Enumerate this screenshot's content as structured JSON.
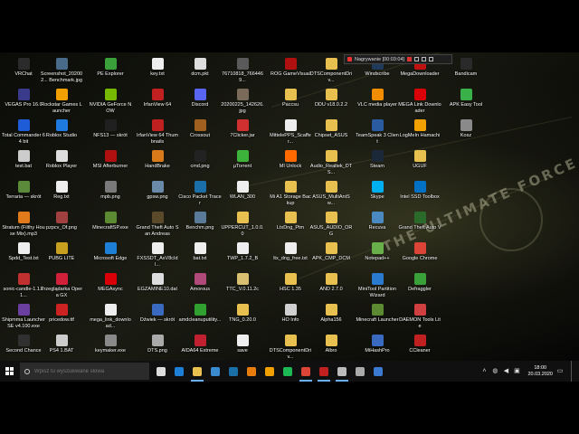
{
  "desktop": {
    "wallpaper_text": "THE ULTIMATE FORCE",
    "columns": [
      [
        {
          "label": "VRChat",
          "icon": "vrchat-icon",
          "color": "#2b2b2b"
        },
        {
          "label": "VEGAS Pro 16.0",
          "icon": "vegas-icon",
          "color": "#3a3a8a"
        },
        {
          "label": "Total Commander 64 bit",
          "icon": "total-commander-icon",
          "color": "#1e5bd6"
        },
        {
          "label": "test.bat",
          "icon": "bat-file-icon",
          "color": "#cccccc"
        },
        {
          "label": "Terraria — skrót",
          "icon": "terraria-icon",
          "color": "#5a8a3a"
        },
        {
          "label": "Stratum (Filthy House Mix).mp3",
          "icon": "mp3-icon",
          "color": "#e07a1a"
        },
        {
          "label": "Spdd_Test.txt",
          "icon": "txt-file-icon",
          "color": "#eeeeee"
        },
        {
          "label": "sonic-candle-1.1.11...",
          "icon": "jar-file-icon",
          "color": "#c03030"
        },
        {
          "label": "Shipmma Launcher SE v4.100.exe",
          "icon": "exe-icon",
          "color": "#6a3fa0"
        },
        {
          "label": "Second Chance",
          "icon": "game-icon",
          "color": "#303030"
        }
      ],
      [
        {
          "label": "Screenshot_202002... Benchmark.jpg",
          "icon": "image-file-icon",
          "color": "#4a6a8a"
        },
        {
          "label": "Rockstar Games Launcher",
          "icon": "rockstar-icon",
          "color": "#f2a000"
        },
        {
          "label": "Roblox Studio",
          "icon": "roblox-studio-icon",
          "color": "#1f7ae0"
        },
        {
          "label": "Roblox Player",
          "icon": "roblox-icon",
          "color": "#dddddd"
        },
        {
          "label": "Reg.txt",
          "icon": "txt-file-icon",
          "color": "#eeeeee"
        },
        {
          "label": "pzpcv_Of.png",
          "icon": "png-file-icon",
          "color": "#a04040"
        },
        {
          "label": "PUBG LITE",
          "icon": "pubg-icon",
          "color": "#c8a020"
        },
        {
          "label": "Przeglądarka Opera GX",
          "icon": "opera-gx-icon",
          "color": "#d0203a"
        },
        {
          "label": "pricedow.ttf",
          "icon": "font-file-icon",
          "color": "#cc2222"
        },
        {
          "label": "PS4 1.BAT",
          "icon": "bat-file-icon",
          "color": "#cccccc"
        }
      ],
      [
        {
          "label": "PE Explorer",
          "icon": "pe-explorer-icon",
          "color": "#3aa03a"
        },
        {
          "label": "NVIDIA GeForce NOW",
          "icon": "nvidia-icon",
          "color": "#76b900"
        },
        {
          "label": "NFS13 — skrót",
          "icon": "nfs-icon",
          "color": "#202020"
        },
        {
          "label": "MSI Afterburner",
          "icon": "msi-afterburner-icon",
          "color": "#b01010"
        },
        {
          "label": "mpb.png",
          "icon": "png-file-icon",
          "color": "#7a7a7a"
        },
        {
          "label": "MinecraftSP.exe",
          "icon": "minecraft-icon",
          "color": "#5b8a32"
        },
        {
          "label": "Microsoft Edge",
          "icon": "edge-icon",
          "color": "#1e7fd6"
        },
        {
          "label": "MEGAsync",
          "icon": "mega-icon",
          "color": "#d90007"
        },
        {
          "label": "mega_link_download...",
          "icon": "txt-file-icon",
          "color": "#eeeeee"
        },
        {
          "label": "keymaker.exe",
          "icon": "exe-icon",
          "color": "#8a8a8a"
        }
      ],
      [
        {
          "label": "key.txt",
          "icon": "txt-file-icon",
          "color": "#eeeeee"
        },
        {
          "label": "IrfanView 64",
          "icon": "irfanview-icon",
          "color": "#c02020"
        },
        {
          "label": "IrfanView 64 Thumbnails",
          "icon": "irfanview-icon",
          "color": "#c02020"
        },
        {
          "label": "HandBrake",
          "icon": "handbrake-icon",
          "color": "#d87a1a"
        },
        {
          "label": "gpsw.png",
          "icon": "png-file-icon",
          "color": "#6a8aaa"
        },
        {
          "label": "Grand Theft Auto San Andreas",
          "icon": "gta-sa-icon",
          "color": "#5a4a2a"
        },
        {
          "label": "FXSSDT_AxV8cIdl...",
          "icon": "txt-file-icon",
          "color": "#eeeeee"
        },
        {
          "label": "EGZAMINE10.dat",
          "icon": "dat-file-icon",
          "color": "#dddddd"
        },
        {
          "label": "Dźwiek — skrót",
          "icon": "shortcut-icon",
          "color": "#3a6ac0"
        },
        {
          "label": "DTS.png",
          "icon": "png-file-icon",
          "color": "#aaaaaa"
        }
      ],
      [
        {
          "label": "dcm.pkt",
          "icon": "pkt-file-icon",
          "color": "#dddddd"
        },
        {
          "label": "Discord",
          "icon": "discord-icon",
          "color": "#5865f2"
        },
        {
          "label": "Crossout",
          "icon": "crossout-icon",
          "color": "#a06020"
        },
        {
          "label": "cmd.png",
          "icon": "png-file-icon",
          "color": "#222222"
        },
        {
          "label": "Cisco Packet Tracer",
          "icon": "cisco-icon",
          "color": "#1b6fa8"
        },
        {
          "label": "Benchm.png",
          "icon": "png-file-icon",
          "color": "#5a7a9a"
        },
        {
          "label": "bat.txt",
          "icon": "txt-file-icon",
          "color": "#eeeeee"
        },
        {
          "label": "Amorous",
          "icon": "game-icon",
          "color": "#b04a7a"
        },
        {
          "label": "amdcleanuputility...",
          "icon": "amd-icon",
          "color": "#30a030"
        },
        {
          "label": "AIDA64 Extreme",
          "icon": "aida64-icon",
          "color": "#c02030"
        }
      ],
      [
        {
          "label": "76710818_7664469...",
          "icon": "image-file-icon",
          "color": "#5a5a5a"
        },
        {
          "label": "20200225_142626.jpg",
          "icon": "image-file-icon",
          "color": "#7a6a5a"
        },
        {
          "label": "7Clicker.jar",
          "icon": "jar-file-icon",
          "color": "#d03030"
        },
        {
          "label": "µTorrent",
          "icon": "utorrent-icon",
          "color": "#3cb43c"
        },
        {
          "label": "WLAN_300",
          "icon": "txt-file-icon",
          "color": "#eeeeee"
        },
        {
          "label": "UPPERCUT_1.0.0.0",
          "icon": "folder-icon",
          "color": "#e8c050"
        },
        {
          "label": "TWP_1.7.2_B",
          "icon": "txt-file-icon",
          "color": "#eeeeee"
        },
        {
          "label": "TTC_V.0.11.2c",
          "icon": "exe-icon",
          "color": "#d8c070"
        },
        {
          "label": "TNG_0.20.0",
          "icon": "folder-icon",
          "color": "#e8c050"
        },
        {
          "label": "save",
          "icon": "txt-file-icon",
          "color": "#eeeeee"
        }
      ],
      [
        {
          "label": "ROG GameVisual",
          "icon": "rog-icon",
          "color": "#b01010"
        },
        {
          "label": "Paccsu",
          "icon": "folder-icon",
          "color": "#e8c050"
        },
        {
          "label": "MittelePPS_Scaffer...",
          "icon": "txt-file-icon",
          "color": "#eeeeee"
        },
        {
          "label": "MI Unlock",
          "icon": "mi-unlock-icon",
          "color": "#ff6900"
        },
        {
          "label": "Mi A1 Storage Backup",
          "icon": "folder-icon",
          "color": "#e8c050"
        },
        {
          "label": "LtxDng_Ptm",
          "icon": "folder-icon",
          "color": "#e8c050"
        },
        {
          "label": "ltx_dng_free.txt",
          "icon": "txt-file-icon",
          "color": "#eeeeee"
        },
        {
          "label": "HSC 1.35",
          "icon": "folder-icon",
          "color": "#e8c050"
        },
        {
          "label": "HO Info",
          "icon": "info-icon",
          "color": "#d0d0d0"
        },
        {
          "label": "DTSComponentDriv...",
          "icon": "folder-icon",
          "color": "#e8c050"
        }
      ],
      [
        {
          "label": "DTSComponentDriv...",
          "icon": "folder-icon",
          "color": "#e8c050"
        },
        {
          "label": "DDU v18.0.2.2",
          "icon": "folder-icon",
          "color": "#e8c050"
        },
        {
          "label": "Chipset_ASUS",
          "icon": "folder-icon",
          "color": "#e8c050"
        },
        {
          "label": "Audio_Realtek_DTS...",
          "icon": "folder-icon",
          "color": "#e8c050"
        },
        {
          "label": "ASUS_MultiAntSw...",
          "icon": "folder-icon",
          "color": "#e8c050"
        },
        {
          "label": "ASUS_AUDIO_ORG",
          "icon": "folder-icon",
          "color": "#e8c050"
        },
        {
          "label": "APK_CMP_DCM",
          "icon": "folder-icon",
          "color": "#e8c050"
        },
        {
          "label": "AND 2.7.0",
          "icon": "folder-icon",
          "color": "#e8c050"
        },
        {
          "label": "Alpha156",
          "icon": "folder-icon",
          "color": "#e8c050"
        },
        {
          "label": "Albro",
          "icon": "folder-icon",
          "color": "#e8c050"
        }
      ],
      [
        {
          "label": "Windscribe",
          "icon": "windscribe-icon",
          "color": "#1f3a5a"
        },
        {
          "label": "VLC media player",
          "icon": "vlc-icon",
          "color": "#f28c00"
        },
        {
          "label": "TeamSpeak 3 Client",
          "icon": "teamspeak-icon",
          "color": "#2a5aa0"
        },
        {
          "label": "Steam",
          "icon": "steam-icon",
          "color": "#1b2838"
        },
        {
          "label": "Skype",
          "icon": "skype-icon",
          "color": "#00aff0"
        },
        {
          "label": "Recuva",
          "icon": "recuva-icon",
          "color": "#4a8ac0"
        },
        {
          "label": "Notepad++",
          "icon": "notepadpp-icon",
          "color": "#6ab04a"
        },
        {
          "label": "MiniTool Partition Wizard",
          "icon": "minitool-icon",
          "color": "#2a7ad0"
        },
        {
          "label": "Minecraft Launcher",
          "icon": "minecraft-icon",
          "color": "#5b8a32"
        },
        {
          "label": "MiHashPro",
          "icon": "shortcut-icon",
          "color": "#3a6ac0"
        }
      ],
      [
        {
          "label": "MegaDownloader",
          "icon": "megadownloader-icon",
          "color": "#c01010"
        },
        {
          "label": "MEGA Link Downloader",
          "icon": "mega-icon",
          "color": "#d90007"
        },
        {
          "label": "LogMeIn Hamachi",
          "icon": "hamachi-icon",
          "color": "#f2a000"
        },
        {
          "label": "UGUF",
          "icon": "folder-icon",
          "color": "#e8c050"
        },
        {
          "label": "Intel SSD Toolbox",
          "icon": "intel-icon",
          "color": "#0071c5"
        },
        {
          "label": "Grand Theft Auto V",
          "icon": "gta-v-icon",
          "color": "#2a6a2a"
        },
        {
          "label": "Google Chrome",
          "icon": "chrome-icon",
          "color": "#db4437"
        },
        {
          "label": "Defraggler",
          "icon": "defraggler-icon",
          "color": "#3aa03a"
        },
        {
          "label": "DAEMON Tools Lite",
          "icon": "daemon-tools-icon",
          "color": "#d04040"
        },
        {
          "label": "CCleaner",
          "icon": "ccleaner-icon",
          "color": "#c02020"
        }
      ],
      [
        {
          "label": "Bandicam",
          "icon": "bandicam-icon",
          "color": "#2a2a2a"
        },
        {
          "label": "APK Easy Tool",
          "icon": "apk-icon",
          "color": "#3ab04a"
        },
        {
          "label": "Kosz",
          "icon": "recycle-bin-icon",
          "color": "#8a8a8a"
        }
      ]
    ]
  },
  "recorder": {
    "label": "Nagrywanie [00:03:04]"
  },
  "taskbar": {
    "search_placeholder": "Wpisz tu wyszukiwane słowa",
    "apps": [
      {
        "name": "task-view-icon",
        "color": "#dddddd",
        "active": false
      },
      {
        "name": "edge-icon",
        "color": "#1e7fd6",
        "active": false
      },
      {
        "name": "file-explorer-icon",
        "color": "#e8c050",
        "active": true
      },
      {
        "name": "store-icon",
        "color": "#3a8ad0",
        "active": false
      },
      {
        "name": "cisco-icon",
        "color": "#1b6fa8",
        "active": false
      },
      {
        "name": "blender-icon",
        "color": "#e87d0d",
        "active": false
      },
      {
        "name": "rockstar-icon",
        "color": "#f2a000",
        "active": false
      },
      {
        "name": "spotify-icon",
        "color": "#1db954",
        "active": false
      },
      {
        "name": "chrome-icon",
        "color": "#db4437",
        "active": true
      },
      {
        "name": "bandicam-icon",
        "color": "#c02020",
        "active": true
      },
      {
        "name": "settings-icon",
        "color": "#bbbbbb",
        "active": true
      },
      {
        "name": "file-icon",
        "color": "#aaaaaa",
        "active": false
      },
      {
        "name": "windscribe-icon",
        "color": "#3a7ad0",
        "active": false
      }
    ],
    "time": "18:00",
    "date": "20.03.2020"
  }
}
